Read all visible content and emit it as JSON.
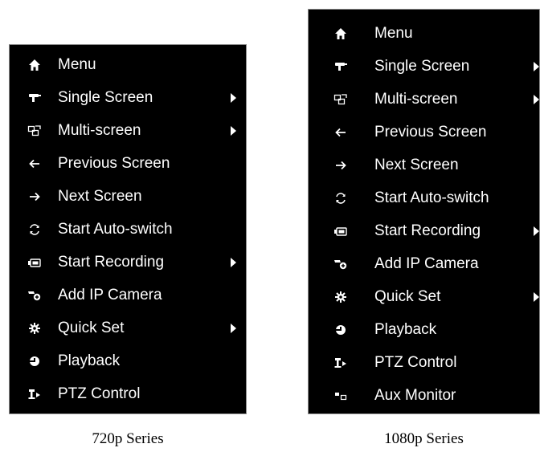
{
  "panels": {
    "p720": {
      "caption": "720p Series",
      "items": [
        {
          "label": "Menu",
          "icon": "home-icon",
          "submenu": false
        },
        {
          "label": "Single Screen",
          "icon": "single-screen-icon",
          "submenu": true
        },
        {
          "label": "Multi-screen",
          "icon": "multi-screen-icon",
          "submenu": true
        },
        {
          "label": "Previous Screen",
          "icon": "arrow-left-icon",
          "submenu": false
        },
        {
          "label": "Next Screen",
          "icon": "arrow-right-icon",
          "submenu": false
        },
        {
          "label": "Start Auto-switch",
          "icon": "refresh-icon",
          "submenu": false
        },
        {
          "label": "Start Recording",
          "icon": "recording-icon",
          "submenu": true
        },
        {
          "label": "Add IP Camera",
          "icon": "add-camera-icon",
          "submenu": false
        },
        {
          "label": "Quick Set",
          "icon": "gear-icon",
          "submenu": true
        },
        {
          "label": "Playback",
          "icon": "playback-icon",
          "submenu": false
        },
        {
          "label": "PTZ Control",
          "icon": "ptz-icon",
          "submenu": false
        }
      ]
    },
    "p1080": {
      "caption": "1080p Series",
      "items": [
        {
          "label": "Menu",
          "icon": "home-icon",
          "submenu": false
        },
        {
          "label": "Single Screen",
          "icon": "single-screen-icon",
          "submenu": true
        },
        {
          "label": "Multi-screen",
          "icon": "multi-screen-icon",
          "submenu": true
        },
        {
          "label": "Previous Screen",
          "icon": "arrow-left-icon",
          "submenu": false
        },
        {
          "label": "Next Screen",
          "icon": "arrow-right-icon",
          "submenu": false
        },
        {
          "label": "Start Auto-switch",
          "icon": "refresh-icon",
          "submenu": false
        },
        {
          "label": "Start Recording",
          "icon": "recording-icon",
          "submenu": true
        },
        {
          "label": "Add IP Camera",
          "icon": "add-camera-icon",
          "submenu": false
        },
        {
          "label": "Quick Set",
          "icon": "gear-icon",
          "submenu": true
        },
        {
          "label": "Playback",
          "icon": "playback-icon",
          "submenu": false
        },
        {
          "label": "PTZ Control",
          "icon": "ptz-icon",
          "submenu": false
        },
        {
          "label": "Aux Monitor",
          "icon": "aux-monitor-icon",
          "submenu": false
        }
      ]
    }
  },
  "colors": {
    "menu_background": "#000000",
    "menu_text": "#ffffff",
    "panel_border": "#8a8a8a",
    "page_background": "#ffffff"
  }
}
